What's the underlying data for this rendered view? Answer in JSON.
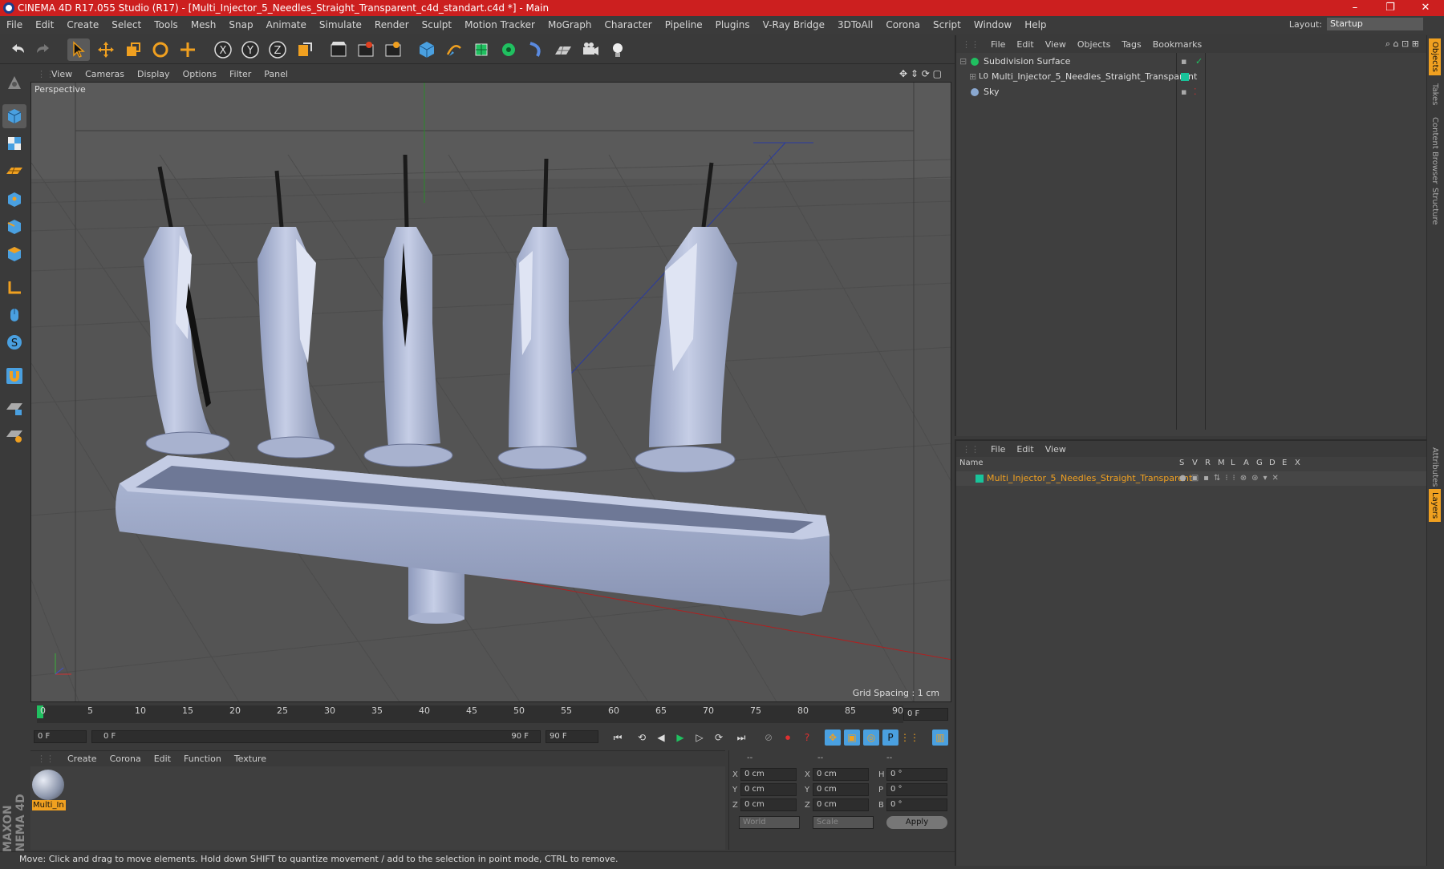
{
  "window": {
    "title": "CINEMA 4D R17.055 Studio (R17) - [Multi_Injector_5_Needles_Straight_Transparent_c4d_standart.c4d *] - Main",
    "controls": [
      "–",
      "❐",
      "✕"
    ]
  },
  "menubar": [
    "File",
    "Edit",
    "Create",
    "Select",
    "Tools",
    "Mesh",
    "Snap",
    "Animate",
    "Simulate",
    "Render",
    "Sculpt",
    "Motion Tracker",
    "MoGraph",
    "Character",
    "Pipeline",
    "Plugins",
    "V-Ray Bridge",
    "3DToAll",
    "Corona",
    "Script",
    "Window",
    "Help"
  ],
  "layout": {
    "label": "Layout:",
    "value": "Startup"
  },
  "viewport": {
    "menu": [
      "View",
      "Cameras",
      "Display",
      "Options",
      "Filter",
      "Panel"
    ],
    "label": "Perspective",
    "grid_spacing": "Grid Spacing : 1 cm"
  },
  "timeline": {
    "ticks": [
      "0",
      "5",
      "10",
      "15",
      "20",
      "25",
      "30",
      "35",
      "40",
      "45",
      "50",
      "55",
      "60",
      "65",
      "70",
      "75",
      "80",
      "85",
      "90"
    ],
    "current_frame": "0 F"
  },
  "transport": {
    "start": "0 F",
    "range_start": "0 F",
    "range_end": "90 F",
    "end": "90 F"
  },
  "material_manager": {
    "menu": [
      "Create",
      "Corona",
      "Edit",
      "Function",
      "Texture"
    ],
    "material_name": "Multi_In"
  },
  "coordinates": {
    "headers": [
      "--",
      "--",
      "--"
    ],
    "rows": [
      {
        "a": "X",
        "av": "0 cm",
        "b": "X",
        "bv": "0 cm",
        "c": "H",
        "cv": "0 °"
      },
      {
        "a": "Y",
        "av": "0 cm",
        "b": "Y",
        "bv": "0 cm",
        "c": "P",
        "cv": "0 °"
      },
      {
        "a": "Z",
        "av": "0 cm",
        "b": "Z",
        "bv": "0 cm",
        "c": "B",
        "cv": "0 °"
      }
    ],
    "world": "World",
    "scale": "Scale",
    "apply": "Apply"
  },
  "status": "Move: Click and drag to move elements. Hold down SHIFT to quantize movement / add to the selection in point mode, CTRL to remove.",
  "object_manager": {
    "menu": [
      "File",
      "Edit",
      "View",
      "Objects",
      "Tags",
      "Bookmarks"
    ],
    "objects": [
      "Subdivision Surface",
      "Multi_Injector_5_Needles_Straight_Transparent",
      "Sky"
    ]
  },
  "layer_manager": {
    "menu": [
      "File",
      "Edit",
      "View"
    ],
    "columns": [
      "Name",
      "S",
      "V",
      "R",
      "M",
      "L",
      "A",
      "G",
      "D",
      "E",
      "X"
    ],
    "layer": "Multi_Injector_5_Needles_Straight_Transparent"
  },
  "side_tabs": [
    "Objects",
    "Takes",
    "Content Browser",
    "Structure",
    "Attributes",
    "Layers"
  ],
  "maxon_logo": "MAXON CINEMA 4D",
  "colors": {
    "title_red": "#cc1f1f",
    "accent_orange": "#f0a020",
    "layer_green": "#19c39a"
  }
}
